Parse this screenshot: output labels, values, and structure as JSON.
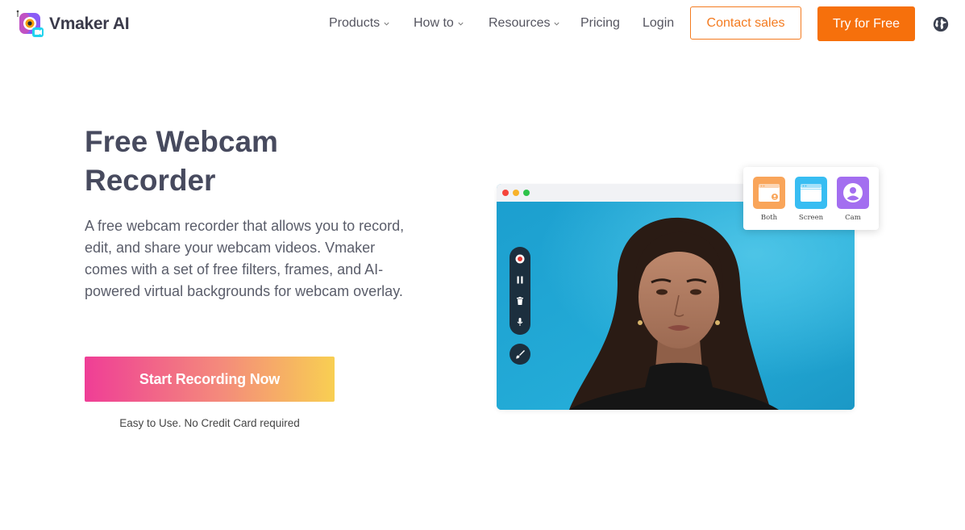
{
  "brand": {
    "name": "Vmaker AI"
  },
  "nav": {
    "products": "Products",
    "how_to": "How to",
    "resources": "Resources",
    "pricing": "Pricing",
    "login": "Login"
  },
  "header": {
    "contact_sales": "Contact sales",
    "try_free": "Try for Free",
    "language_icon": "globe-icon"
  },
  "hero": {
    "title": "Free Webcam Recorder",
    "description": "A free webcam recorder that allows you to record, edit, and share your webcam videos. Vmaker comes with a set of free filters, frames, and AI-powered virtual backgrounds for webcam overlay.",
    "cta": "Start Recording Now",
    "note": "Easy to Use. No Credit Card required"
  },
  "mockup": {
    "toolbar_icons": [
      "record-icon",
      "pause-icon",
      "trash-icon",
      "mic-icon",
      "brush-icon"
    ],
    "modes": [
      {
        "label": "Both",
        "color": "#f9a55a"
      },
      {
        "label": "Screen",
        "color": "#38bdf2"
      },
      {
        "label": "Cam",
        "color": "#a36ef0"
      }
    ]
  },
  "colors": {
    "accent": "#f6700c",
    "title": "#474a5e",
    "video_bg": "#1aa4d0",
    "toolbar": "#1c2f3e",
    "cta_gradient": [
      "#ef3e96",
      "#f48b7b",
      "#f8cf52"
    ]
  }
}
